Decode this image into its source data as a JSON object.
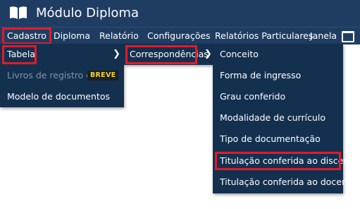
{
  "app": {
    "title": "Módulo Diploma"
  },
  "menubar": {
    "items": [
      "Cadastro",
      "Diploma",
      "Relatório",
      "Configurações",
      "Relatórios Particulares",
      "Janela"
    ]
  },
  "cadastro_menu": {
    "items": [
      {
        "label": "Tabela"
      },
      {
        "label": "Livros de registro de di"
      },
      {
        "label": "Modelo de documentos"
      }
    ],
    "badge": "BREVE"
  },
  "tabela_menu": {
    "items": [
      {
        "label": "Correspondências"
      }
    ]
  },
  "correspondencias_menu": {
    "items": [
      "Conceito",
      "Forma de ingresso",
      "Grau conferido",
      "Modalidade de currículo",
      "Tipo de documentação",
      "Titulação conferida ao discente",
      "Titulação conferida ao docente"
    ]
  },
  "colors": {
    "bar": "#1f3d63",
    "menu": "#14304f",
    "highlight": "#e01b2a",
    "badge_text": "#f2d230"
  },
  "icons": {
    "app": "book-icon",
    "window": "window-icon",
    "submenu": "chevron-right-icon"
  }
}
